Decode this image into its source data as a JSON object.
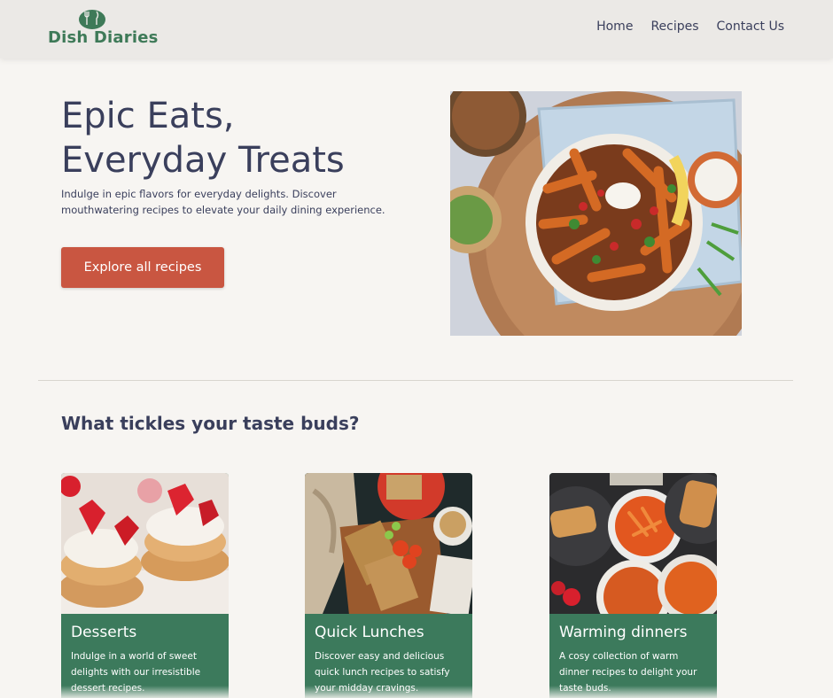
{
  "header": {
    "logo_text": "Dish Diaries",
    "nav": [
      "Home",
      "Recipes",
      "Contact Us"
    ]
  },
  "hero": {
    "title_line1": "Epic Eats,",
    "title_line2": "Everyday Treats",
    "description": "Indulge in epic flavors for everyday delights. Discover mouthwatering recipes to elevate your daily dining experience.",
    "cta_label": "Explore all recipes",
    "image": "loaded-sweet-potato-fries-photo"
  },
  "categories": {
    "title": "What tickles your taste buds?",
    "cards": [
      {
        "title": "Desserts",
        "text": "Indulge in a world of sweet delights with our irresistible dessert recipes.",
        "image": "strawberry-cream-pastries-photo"
      },
      {
        "title": "Quick Lunches",
        "text": "Discover easy and delicious quick lunch recipes to satisfy your midday cravings.",
        "image": "grilled-sandwich-board-photo"
      },
      {
        "title": "Warming dinners",
        "text": "A cosy collection of warm dinner recipes to delight your taste buds.",
        "image": "pasta-dinner-table-photo"
      }
    ]
  },
  "colors": {
    "brand_green": "#3e7a58",
    "card_green": "#3c7a5c",
    "cta_red": "#c95641",
    "text_navy": "#3a3f5c",
    "background": "#f7f5f2",
    "header_bg": "#ebe9e6"
  }
}
